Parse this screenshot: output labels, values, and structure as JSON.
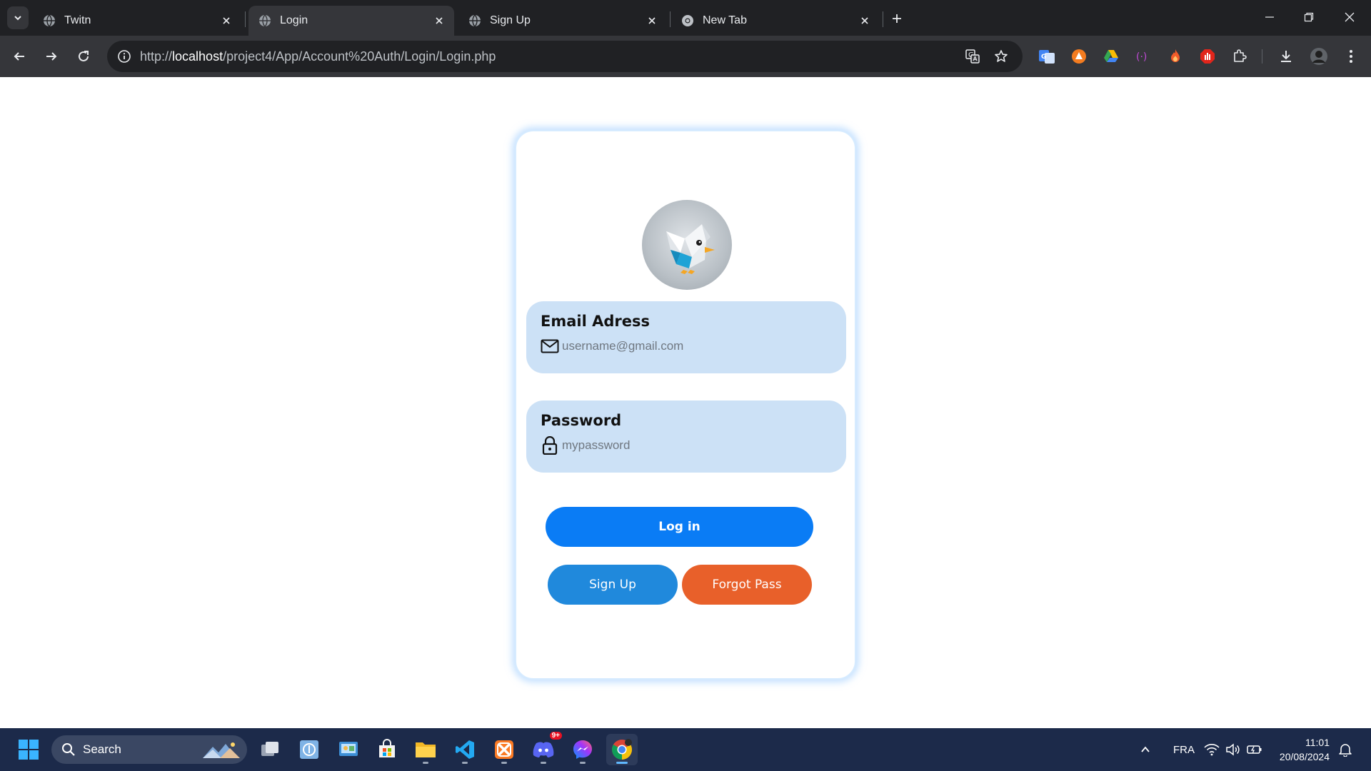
{
  "browser": {
    "tabs": [
      {
        "title": "Twitn",
        "active": false
      },
      {
        "title": "Login",
        "active": true
      },
      {
        "title": "Sign Up",
        "active": false
      },
      {
        "title": "New Tab",
        "active": false
      }
    ],
    "url_prefix": "http://",
    "url_host": "localhost",
    "url_path": "/project4/App/Account%20Auth/Login/Login.php"
  },
  "login": {
    "email": {
      "label": "Email Adress",
      "placeholder": "username@gmail.com",
      "icon": "envelope-icon"
    },
    "password": {
      "label": "Password",
      "placeholder": "mypassword",
      "icon": "lock-icon"
    },
    "login_button": "Log in",
    "signup_button": "Sign Up",
    "forgot_button": "Forgot Pass",
    "colors": {
      "login": "#0a7cf5",
      "signup": "#2089dc",
      "forgot": "#e8602a",
      "field_bg": "#cce1f6"
    }
  },
  "taskbar": {
    "search_label": "Search",
    "discord_badge": "9+",
    "language": "FRA",
    "time": "11:01",
    "date": "20/08/2024"
  }
}
